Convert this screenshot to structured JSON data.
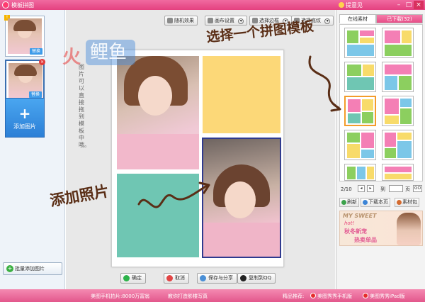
{
  "window": {
    "title": "模板拼图",
    "feedback": "提意见",
    "min_glyph": "–",
    "max_glyph": "□",
    "close_glyph": "×"
  },
  "left_panel": {
    "thumbnails": [
      {
        "replace_label": "替换",
        "badge": "!"
      },
      {
        "replace_label": "替换",
        "close": "×"
      }
    ],
    "add_photo_plus": "+",
    "add_photo_label": "添加图片",
    "batch_add_label": "批量添加图片",
    "batch_add_icon": "+"
  },
  "toolbar": {
    "random_label": "随机效果",
    "canvas_settings_label": "画布设置",
    "border_label": "选择边框",
    "texture_label": "选择底纹",
    "chevron": "▾"
  },
  "watermark": {
    "fire": "火",
    "brand": "鲤鱼"
  },
  "canvas": {
    "vertical_note": "图片可以直接拖到模板中哦。"
  },
  "callouts": {
    "choose_template": "选择一个拼图模板",
    "add_photo": "添加照片"
  },
  "actions": {
    "ok_label": "确定",
    "cancel_label": "取消",
    "save_share_label": "保存与分享",
    "copy_qq_label": "复制到QQ"
  },
  "right_panel": {
    "tab_online": "在线素材",
    "tab_downloaded": "已下载(32)",
    "pager": {
      "page_text": "2/10",
      "prev": "◂",
      "next": "▸",
      "goto_prefix": "到",
      "goto_suffix": "页",
      "go_label": "GO"
    },
    "refresh_label": "刷新",
    "download_page_label": "下载本页",
    "material_pack_label": "素材包",
    "ad": {
      "brand": "MY SWEET",
      "hot": "hot!",
      "line1": "秋冬新宠",
      "line2": "热卖单品"
    }
  },
  "status_bar": {
    "text1": "美图手机拍片:8000万富翁",
    "text2": "教你打造影楼写真",
    "text3": "精品推荐:",
    "link1": "美图秀秀手机版",
    "link2": "美图秀秀iPad版"
  },
  "colors": {
    "accent_pink": "#e74e87",
    "tpl_pink": "#f47fb5",
    "tpl_green": "#8ccf5f",
    "tpl_yellow": "#f8db6a",
    "tpl_blue": "#7cc7e8",
    "tpl_teal": "#6fc6b3",
    "selected_border": "#f39c2b",
    "callout_brown": "#5a2e16"
  }
}
